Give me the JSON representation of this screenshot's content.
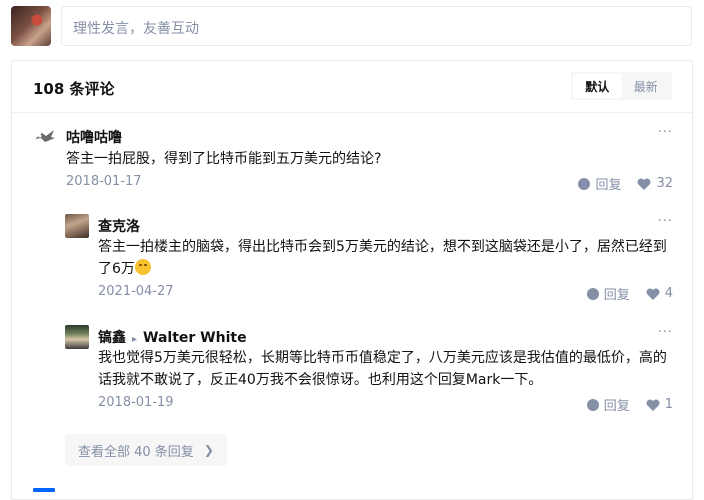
{
  "composer": {
    "placeholder": "理性发言，友善互动"
  },
  "comments_header": {
    "title": "108 条评论",
    "sort_tabs": [
      "默认",
      "最新"
    ],
    "active_sort": "默认"
  },
  "comments": [
    {
      "author": "咕噜咕噜",
      "reply_to": "",
      "content": "答主一拍屁股，得到了比特币能到五万美元的结论?",
      "emoji": false,
      "date": "2018-01-17",
      "reply_label": "回复",
      "likes": "32",
      "more": "···"
    },
    {
      "author": "查克洛",
      "reply_to": "",
      "content": "答主一拍楼主的脑袋，得出比特币会到5万美元的结论，想不到这脑袋还是小了，居然已经到了6万",
      "emoji": true,
      "date": "2021-04-27",
      "reply_label": "回复",
      "likes": "4",
      "more": "···"
    },
    {
      "author": "镐鑫",
      "reply_to": "Walter White",
      "content": "我也觉得5万美元很轻松，长期等比特币币值稳定了，八万美元应该是我估值的最低价，高的话我就不敢说了，反正40万我不会很惊讶。也利用这个回复Mark一下。",
      "emoji": false,
      "date": "2018-01-19",
      "reply_label": "回复",
      "likes": "1",
      "more": "···"
    }
  ],
  "view_all": {
    "label": "查看全部 40 条回复",
    "chevron": "❯"
  },
  "colors": {
    "accent": "#0066ff",
    "muted": "#8590a6",
    "text": "#121212"
  }
}
